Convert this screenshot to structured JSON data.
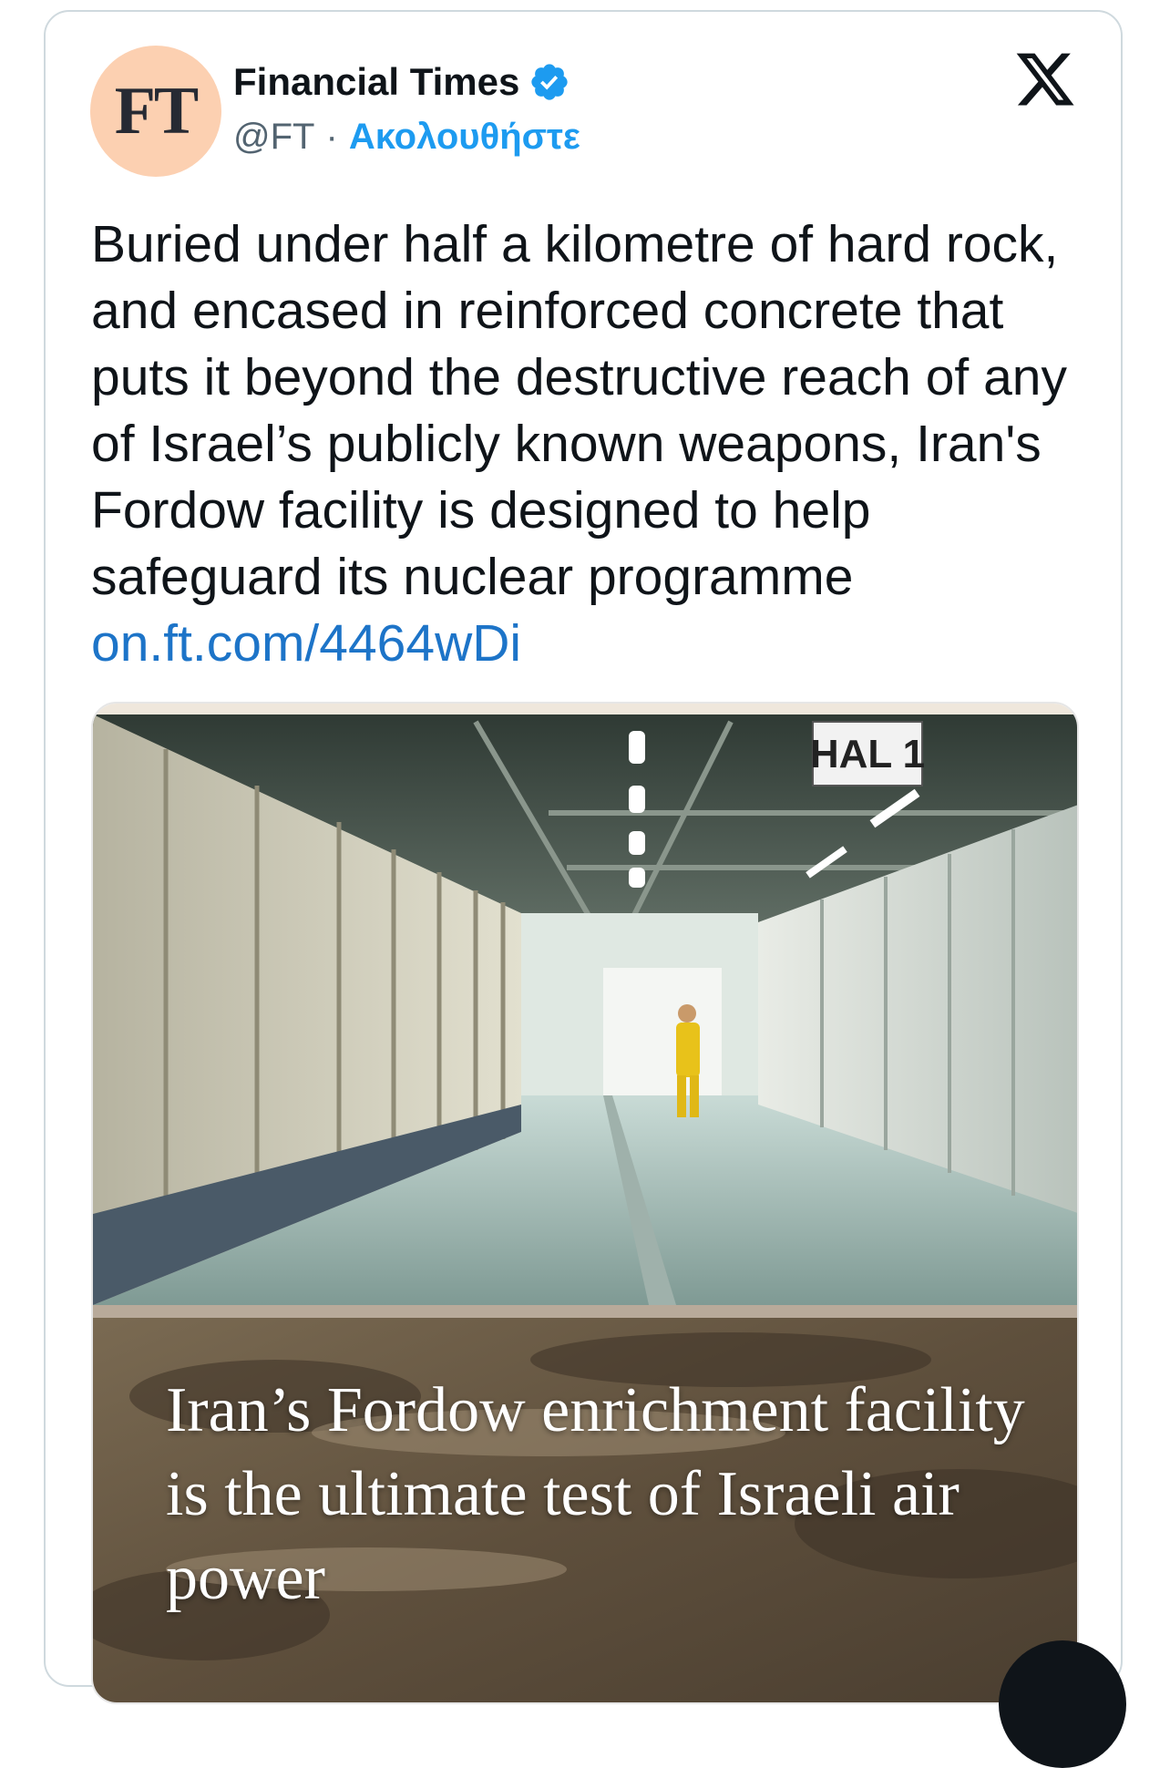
{
  "account": {
    "avatar_text": "FT",
    "name": "Financial Times",
    "handle": "@FT",
    "separator": "·",
    "follow_label": "Ακολουθήστε",
    "verified": true,
    "icons": {
      "verified": "verified-badge-icon",
      "platform": "x-logo-icon"
    }
  },
  "tweet": {
    "text": "Buried under half a kilometre of hard rock, and encased in reinforced concrete that puts it beyond the destructive reach of any of Israel’s publicly known weapons, Iran's Fordow facility is designed to help safeguard its nuclear programme",
    "link": "on.ft.com/4464wDi"
  },
  "media": {
    "sign_text": "HAL 1",
    "headline": "Iran’s Fordow enrichment facility is the ultimate test of Israeli air power"
  },
  "colors": {
    "avatar_bg": "#fcd0b1",
    "follow": "#1d9bf0",
    "link": "#1d74c8",
    "verified": "#1d9bf0"
  }
}
